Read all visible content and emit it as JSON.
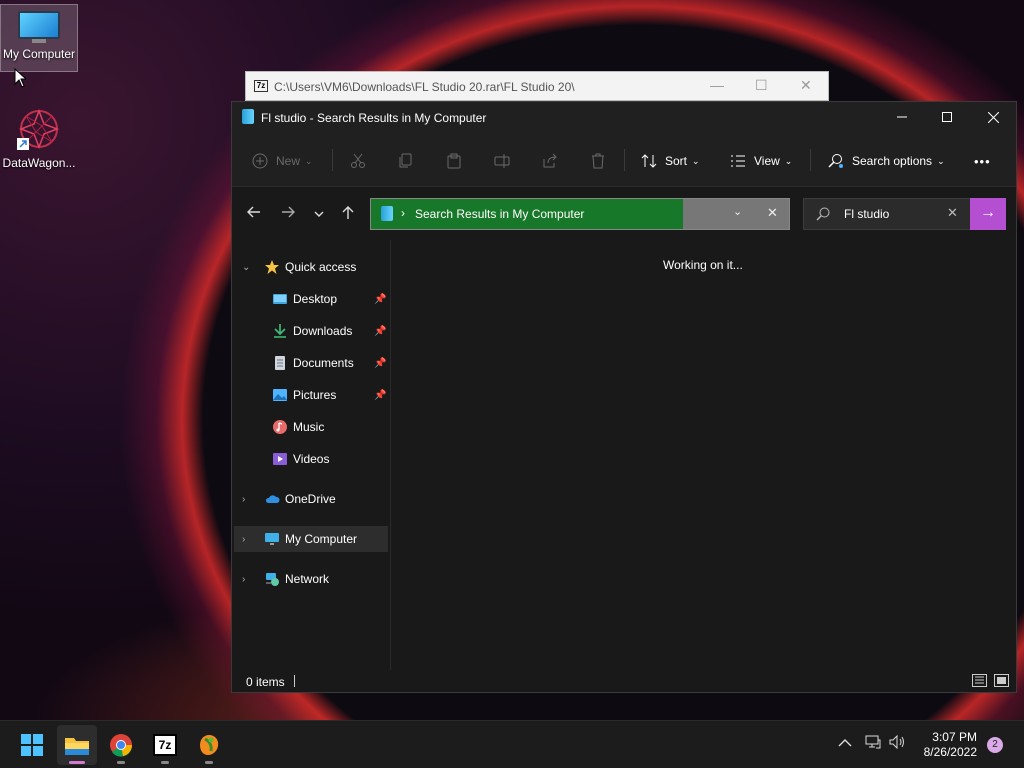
{
  "desktop": {
    "icons": [
      {
        "label": "My Computer"
      },
      {
        "label": "DataWagon..."
      }
    ]
  },
  "bg_window": {
    "title": "C:\\Users\\VM6\\Downloads\\FL Studio 20.rar\\FL Studio 20\\"
  },
  "explorer": {
    "title": "Fl studio - Search Results in My Computer",
    "toolbar": {
      "new_label": "New",
      "sort_label": "Sort",
      "view_label": "View",
      "search_options_label": "Search options",
      "more_label": "•••"
    },
    "address": {
      "path": "Search Results in My Computer"
    },
    "search": {
      "value": "Fl studio"
    },
    "nav": {
      "quick_access": "Quick access",
      "items": [
        {
          "label": "Desktop",
          "pinned": true
        },
        {
          "label": "Downloads",
          "pinned": true
        },
        {
          "label": "Documents",
          "pinned": true
        },
        {
          "label": "Pictures",
          "pinned": true
        },
        {
          "label": "Music",
          "pinned": false
        },
        {
          "label": "Videos",
          "pinned": false
        }
      ],
      "onedrive": "OneDrive",
      "my_computer": "My Computer",
      "network": "Network"
    },
    "content": {
      "status_message": "Working on it..."
    },
    "statusbar": {
      "count": "0 items"
    }
  },
  "taskbar": {
    "apps": [
      "start-icon",
      "file-explorer-icon",
      "chrome-icon",
      "7zip-icon",
      "fl-studio-icon"
    ],
    "seven_zip_label": "7z",
    "time": "3:07 PM",
    "date": "8/26/2022",
    "notification_count": "2"
  },
  "colors": {
    "address_highlight": "#17782a",
    "search_go": "#b34fd0",
    "window_bg": "#191919"
  }
}
